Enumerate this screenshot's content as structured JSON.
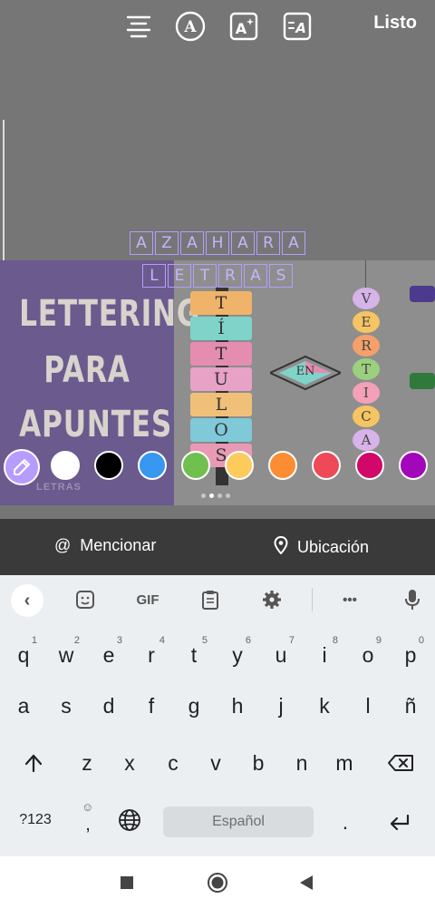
{
  "header": {
    "done_label": "Listo",
    "tools": [
      "align-icon",
      "font-style-icon",
      "text-effect-icon",
      "text-animation-icon"
    ]
  },
  "sticker_text": {
    "line1": [
      "A",
      "Z",
      "A",
      "H",
      "A",
      "R",
      "A"
    ],
    "line2": [
      "L",
      "E",
      "T",
      "R",
      "A",
      "S"
    ]
  },
  "photo": {
    "card_words": [
      "LETTERING",
      "PARA",
      "APUNTES"
    ],
    "watermark": "LETRAS",
    "tiles": [
      "T",
      "Í",
      "T",
      "U",
      "L",
      "O",
      "S"
    ],
    "diamond_text": "EN",
    "beads": [
      "V",
      "E",
      "R",
      "T",
      "I",
      "C",
      "A"
    ]
  },
  "colors": {
    "picker_accent": "#b79cff",
    "swatches": [
      "#ffffff",
      "#000000",
      "#3897f0",
      "#70c050",
      "#fdcb5c",
      "#fd8d32",
      "#ed4956",
      "#d10869",
      "#a307ba"
    ]
  },
  "actions": {
    "mention_label": "Mencionar",
    "location_label": "Ubicación"
  },
  "keyboard": {
    "toolbar_gif": "GIF",
    "row1": [
      {
        "key": "q",
        "hint": "1"
      },
      {
        "key": "w",
        "hint": "2"
      },
      {
        "key": "e",
        "hint": "3"
      },
      {
        "key": "r",
        "hint": "4"
      },
      {
        "key": "t",
        "hint": "5"
      },
      {
        "key": "y",
        "hint": "6"
      },
      {
        "key": "u",
        "hint": "7"
      },
      {
        "key": "i",
        "hint": "8"
      },
      {
        "key": "o",
        "hint": "9"
      },
      {
        "key": "p",
        "hint": "0"
      }
    ],
    "row2": [
      "a",
      "s",
      "d",
      "f",
      "g",
      "h",
      "j",
      "k",
      "l",
      "ñ"
    ],
    "row3": [
      "z",
      "x",
      "c",
      "v",
      "b",
      "n",
      "m"
    ],
    "symbols_label": "?123",
    "comma_label": ",",
    "space_label": "Español",
    "period_label": "."
  }
}
